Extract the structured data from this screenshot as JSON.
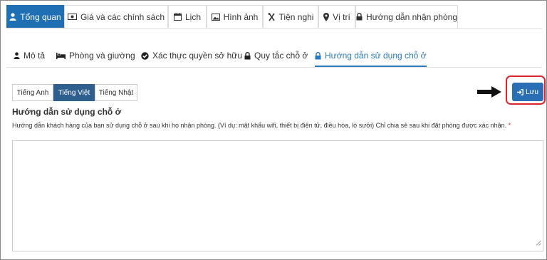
{
  "top_tabs": [
    {
      "label": "Tổng quan",
      "icon": "user-icon"
    },
    {
      "label": "Giá và các chính sách",
      "icon": "money-icon"
    },
    {
      "label": "Lịch",
      "icon": "calendar-icon"
    },
    {
      "label": "Hình ảnh",
      "icon": "image-icon"
    },
    {
      "label": "Tiện nghi",
      "icon": "amenities-icon"
    },
    {
      "label": "Vị trí",
      "icon": "map-marker-icon"
    },
    {
      "label": "Hướng dẫn nhận phòng",
      "icon": "lock-icon"
    }
  ],
  "sub_tabs": [
    {
      "label": "Mô tả",
      "icon": "user-icon"
    },
    {
      "label": "Phòng và giường",
      "icon": "bed-icon"
    },
    {
      "label": "Xác thực quyền sở hữu",
      "icon": "check-circle-icon"
    },
    {
      "label": "Quy tắc chỗ ở",
      "icon": "lock-icon"
    },
    {
      "label": "Hướng dẫn sử dụng chỗ ở",
      "icon": "lock-icon"
    }
  ],
  "languages": [
    "Tiếng Anh",
    "Tiếng Việt",
    "Tiếng Nhật"
  ],
  "save_label": "Lưu",
  "section": {
    "title": "Hướng dẫn sử dụng chỗ ở",
    "help": "Hướng dẫn khách hàng của bạn sử dụng chỗ ở sau khi họ nhận phòng. (Ví dụ: mật khẩu wifi, thiết bị điện tử, điều hòa, lò sưởi) Chỉ chia sẻ sau khi đặt phòng được xác nhận.",
    "required_mark": "*"
  },
  "colors": {
    "primary": "#1f6fb5",
    "active_lang": "#2f5f8f",
    "highlight": "#d9262c"
  }
}
